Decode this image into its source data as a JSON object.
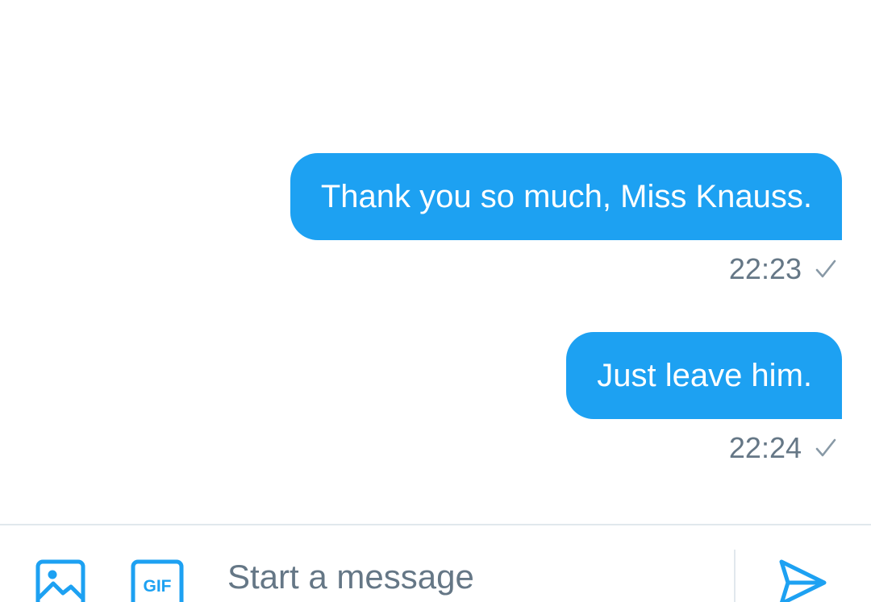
{
  "conversation": {
    "messages": [
      {
        "text": "Thank you so much, Miss Knauss.",
        "time": "22:23",
        "status_icon": "check-icon"
      },
      {
        "text": "Just leave him.",
        "time": "22:24",
        "status_icon": "check-icon"
      }
    ]
  },
  "composer": {
    "placeholder": "Start a message",
    "value": "",
    "image_icon": "image-icon",
    "gif_label": "GIF",
    "send_icon": "send-icon"
  },
  "colors": {
    "bubble": "#1da1f2",
    "bubble_text": "#ffffff",
    "meta_text": "#657786",
    "check": "#8899a6",
    "divider": "#e1e8ed",
    "accent": "#1da1f2"
  }
}
